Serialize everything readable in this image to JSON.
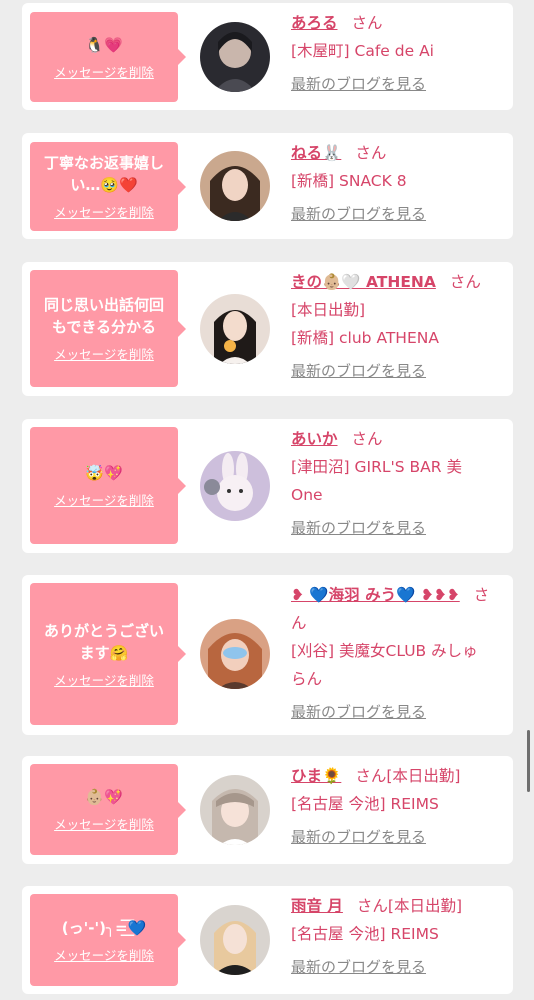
{
  "messages": [
    {
      "bubble_text": "🐧💗",
      "delete_label": "メッセージを削除",
      "name": "あろる",
      "honorific": "さん",
      "extra_status": "",
      "shop_lines": [
        "[木屋町] Cafe de Ai"
      ],
      "blog_link": "最新のブログを見る"
    },
    {
      "bubble_text": "丁寧なお返事嬉しい…🥹❤️",
      "delete_label": "メッセージを削除",
      "name": "ねる🐰",
      "honorific": "さん",
      "extra_status": "",
      "shop_lines": [
        "[新橋] SNACK 8"
      ],
      "blog_link": "最新のブログを見る"
    },
    {
      "bubble_text": "同じ思い出話何回もできる分かる",
      "delete_label": "メッセージを削除",
      "name": "きの👶🏼🤍 ATHENA",
      "honorific": "さん",
      "extra_status": "",
      "shop_lines": [
        "[本日出勤]",
        "[新橋] club ATHENA"
      ],
      "blog_link": "最新のブログを見る"
    },
    {
      "bubble_text": "🤯💖",
      "delete_label": "メッセージを削除",
      "name": "あいか",
      "honorific": "さん",
      "extra_status": "",
      "shop_lines": [
        "[津田沼] GIRL'S BAR 美",
        "One"
      ],
      "blog_link": "最新のブログを見る"
    },
    {
      "bubble_text": "ありがとうございます🤗",
      "delete_label": "メッセージを削除",
      "name": "❥ 💙海羽 みう💙 ❥❥❥",
      "honorific": "さ",
      "extra_status": "",
      "shop_lines": [
        "ん",
        "[刈谷] 美魔女CLUB みしゅ",
        "らん"
      ],
      "blog_link": "最新のブログを見る"
    },
    {
      "bubble_text": "👶🏼💖",
      "delete_label": "メッセージを削除",
      "name": "ひま🌻",
      "honorific": "さん",
      "extra_status": "[本日出勤]",
      "shop_lines": [
        "[名古屋 今池] REIMS"
      ],
      "blog_link": "最新のブログを見る"
    },
    {
      "bubble_text": "(っ'-')╮=͟͟͞͞💙",
      "delete_label": "メッセージを削除",
      "name": "雨音 月",
      "honorific": "さん",
      "extra_status": "[本日出勤]",
      "shop_lines": [
        "[名古屋 今池] REIMS"
      ],
      "blog_link": "最新のブログを見る"
    }
  ],
  "colors": {
    "background": "#ededed",
    "card": "#ffffff",
    "bubble": "#ff99a6",
    "name_pink": "#d64569",
    "link_gray": "#888888"
  }
}
